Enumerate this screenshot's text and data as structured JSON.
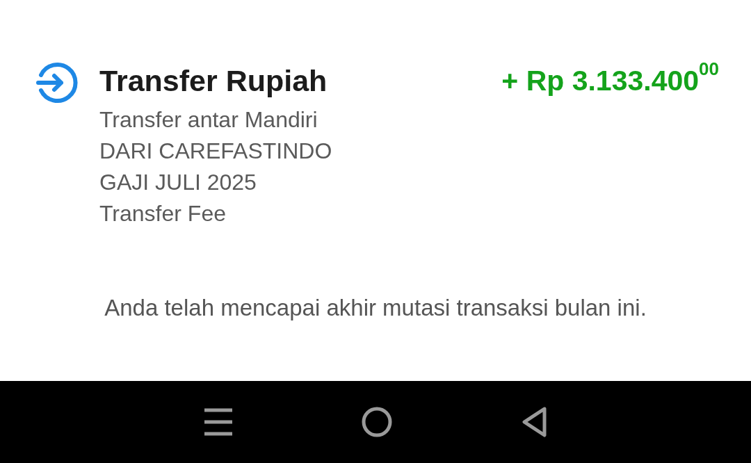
{
  "transaction": {
    "title": "Transfer Rupiah",
    "amount": "+ Rp 3.133.400$^{00}$",
    "details": [
      "Transfer antar Mandiri",
      "DARI CAREFASTINDO",
      "GAJI JULI 2025",
      "Transfer Fee"
    ]
  },
  "end_message": "Anda telah mencapai akhir mutasi transaksi bulan ini."
}
